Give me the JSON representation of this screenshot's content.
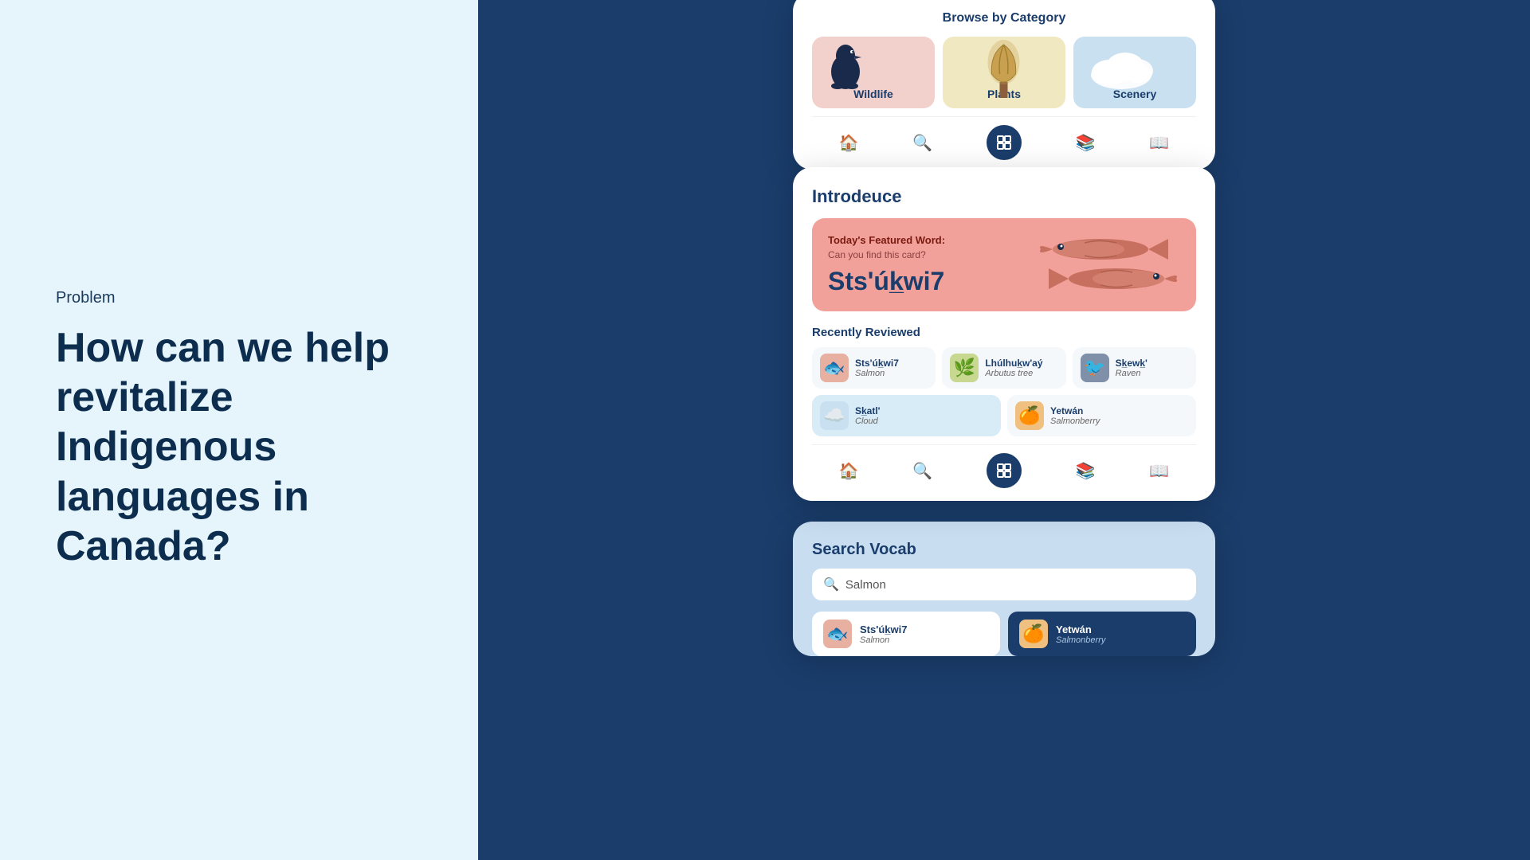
{
  "left": {
    "problem_label": "Problem",
    "heading_line1": "How can we help",
    "heading_line2": "revitalize Indigenous",
    "heading_line3": "languages in Canada?"
  },
  "browse_card": {
    "title": "Browse by Category",
    "categories": [
      {
        "label": "Wildlife",
        "type": "wildlife"
      },
      {
        "label": "Plants",
        "type": "plants"
      },
      {
        "label": "Scenery",
        "type": "scenery"
      }
    ]
  },
  "introdeuce_card": {
    "title": "Introdeuce",
    "featured": {
      "label": "Today's Featured Word:",
      "sublabel": "Can you find this card?",
      "word": "Sts'úk̲wi7"
    },
    "recently_reviewed_title": "Recently Reviewed",
    "words": [
      {
        "indigenous": "Sts'úk̲wi7",
        "english": "Salmon",
        "emoji": "🐟",
        "bg": "#e8b0a0"
      },
      {
        "indigenous": "Lhúlhuk̲w'aý",
        "english": "Arbutus tree",
        "emoji": "🌿",
        "bg": "#c8d890"
      },
      {
        "indigenous": "Sk̲ewk̲'",
        "english": "Raven",
        "emoji": "🐦",
        "bg": "#8090a8"
      },
      {
        "indigenous": "Sk̲atl'",
        "english": "Cloud",
        "emoji": "☁️",
        "bg": "#c8e0f0",
        "blue": true
      },
      {
        "indigenous": "Yetwán",
        "english": "Salmonberry",
        "emoji": "🍊",
        "bg": "#f0c080"
      }
    ]
  },
  "search_card": {
    "title": "Search Vocab",
    "placeholder": "Salmon",
    "results": [
      {
        "indigenous": "Sts'úk̲wi7",
        "english": "Salmon",
        "emoji": "🐟",
        "selected": false
      },
      {
        "indigenous": "Yetwán",
        "english": "Salmonberry",
        "emoji": "🍊",
        "selected": true
      }
    ]
  },
  "nav": {
    "home_icon": "🏠",
    "search_icon": "🔍",
    "library_icon": "📚",
    "book_icon": "📖",
    "center_icon": "⊡"
  }
}
